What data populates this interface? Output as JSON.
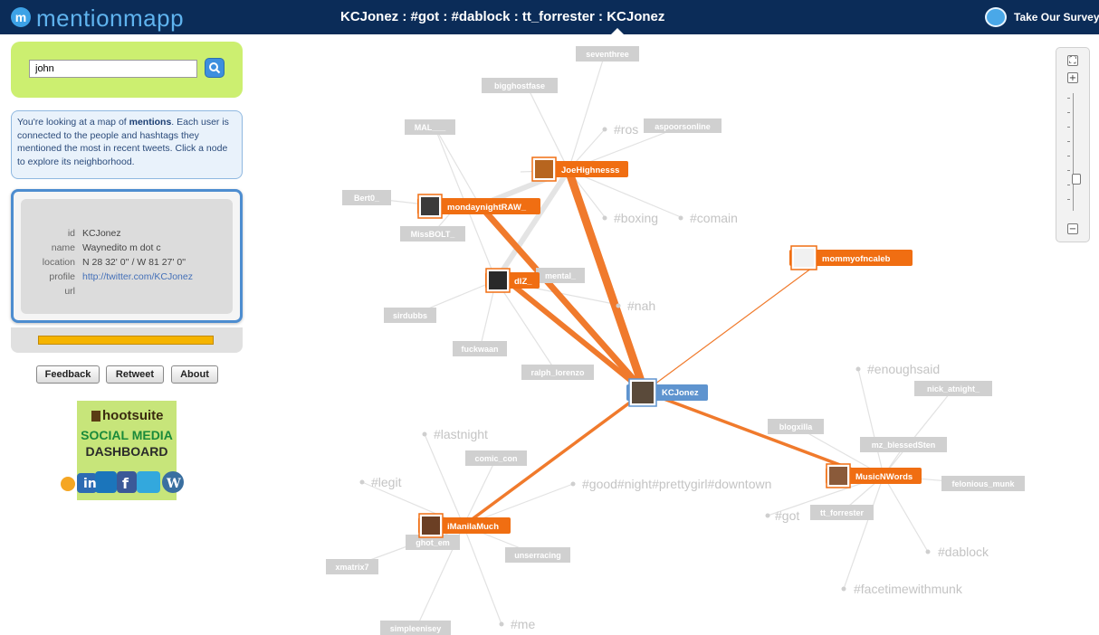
{
  "header": {
    "logo_text": "mentionmapp",
    "breadcrumb": "KCJonez : #got : #dablock : tt_forrester : KCJonez",
    "survey_label": "Take Our Survey!"
  },
  "search": {
    "value": "john",
    "button_icon": "search-icon"
  },
  "info_text_pre": "You're looking at a map of ",
  "info_text_bold": "mentions",
  "info_text_post": ". Each user is connected to the people and hashtags they mentioned the most in recent tweets.  Click a node to explore its neighborhood.",
  "user": {
    "id_label": "id",
    "id": "KCJonez",
    "name_label": "name",
    "name": "Waynedito m dot c",
    "location_label": "location",
    "location": "N 28 32' 0'' / W 81 27' 0''",
    "profile_label": "profile",
    "profile": "http://twitter.com/KCJonez",
    "url_label": "url"
  },
  "progress": 1.0,
  "buttons": {
    "feedback": "Feedback",
    "retweet": "Retweet",
    "about": "About"
  },
  "ad": {
    "brand": "hootsuite",
    "line1": "SOCIAL MEDIA",
    "line2": "DASHBOARD"
  },
  "graph": {
    "center": "KCJonez",
    "active_nodes": {
      "joe": "JoeHighnesss",
      "monday": "mondaynightRAW_",
      "dlz": "dlZ_",
      "mommy": "mommyofncaleb",
      "music": "MusicNWords",
      "imanila": "iManilaMuch"
    },
    "user_nodes": {
      "seventhree": "seventhree",
      "bigghost": "bigghostfase",
      "mal": "MAL___",
      "aspoor": "aspoorsonline",
      "bert": "Bert0_",
      "missbolt": "MissBOLT_",
      "mental": "mental_",
      "sirdubbs": "sirdubbs",
      "fuckwaan": "fuckwaan",
      "ralph": "ralph_lorenzo",
      "nick": "nick_atnight_",
      "blogxilla": "blogxilla",
      "mzblessed": "mz_blessedSten",
      "felonious": "felonious_munk",
      "ttforrester": "tt_forrester",
      "comiccon": "comic_con",
      "ghotem": "ghot_em",
      "unserracing": "unserracing",
      "xmatrix": "xmatrix7",
      "simpleenisey": "simpleenisey"
    },
    "hashtags": {
      "ros": "#ros",
      "boxing": "#boxing",
      "comain": "#comain",
      "nah": "#nah",
      "enoughsaid": "#enoughsaid",
      "lastnight": "#lastnight",
      "legit": "#legit",
      "good": "#good#night#prettygirl#downtown",
      "got": "#got",
      "dablock": "#dablock",
      "facetime": "#facetimewithmunk",
      "me": "#me"
    }
  },
  "zoom": {
    "level": 0.28,
    "fit_icon": "fit-screen-icon",
    "in_icon": "zoom-in-icon",
    "out_icon": "zoom-out-icon"
  }
}
